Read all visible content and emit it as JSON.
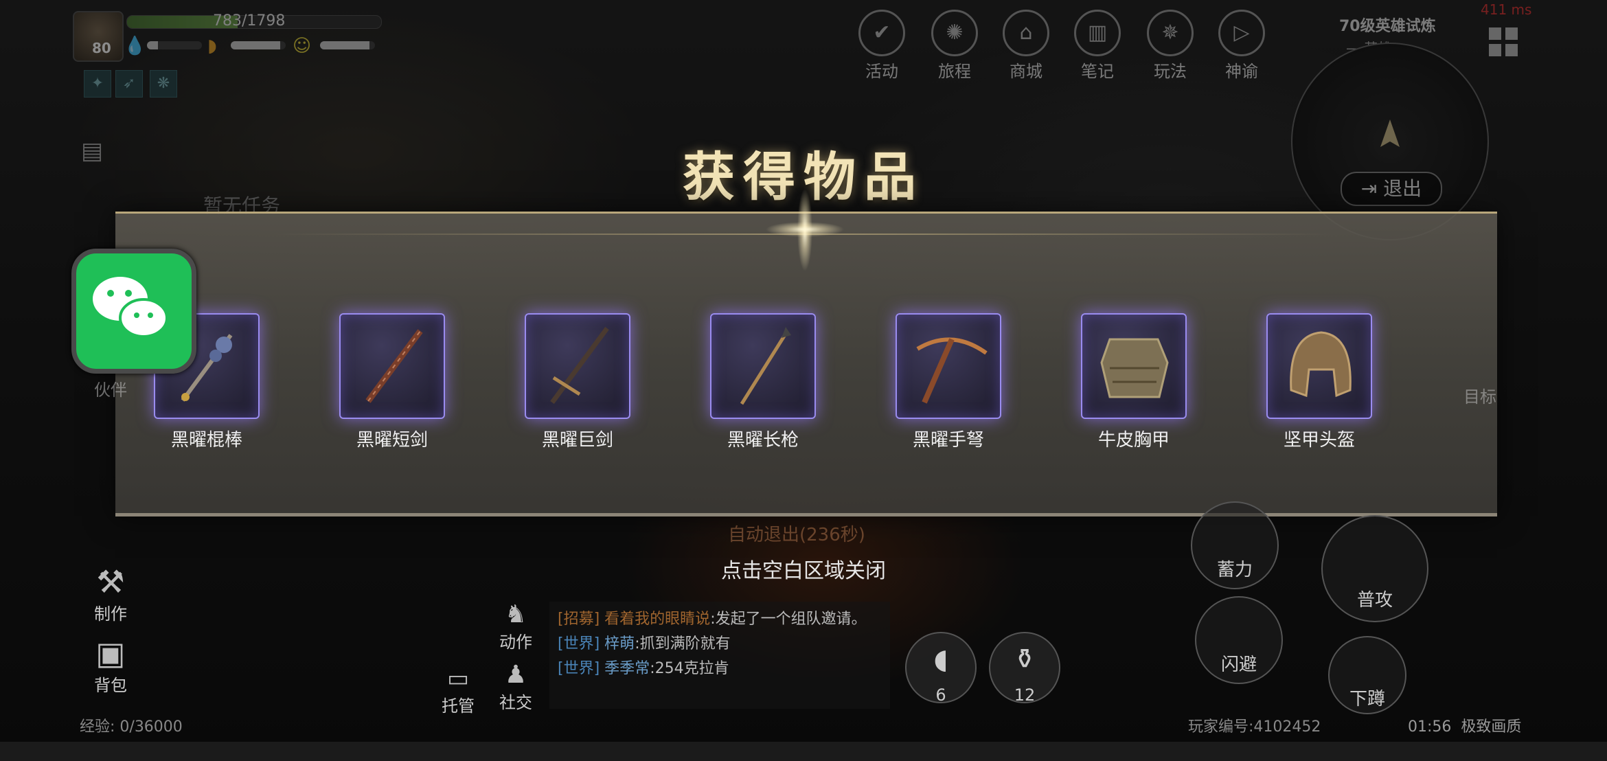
{
  "hud": {
    "level": "80",
    "hp_text": "783/1798",
    "hp_fraction": 0.435,
    "water_fraction": 0.2,
    "hunger_fraction": 0.9,
    "mood_fraction": 0.9,
    "no_task": "暂无任务"
  },
  "top_menu": [
    {
      "label": "活动",
      "icon": "calendar-check-icon"
    },
    {
      "label": "旅程",
      "icon": "journey-icon"
    },
    {
      "label": "商城",
      "icon": "shop-cart-icon"
    },
    {
      "label": "笔记",
      "icon": "notebook-icon"
    },
    {
      "label": "玩法",
      "icon": "compass-icon"
    },
    {
      "label": "神谕",
      "icon": "oracle-icon"
    }
  ],
  "top_right": {
    "trial": "70级英雄试炼",
    "trial_sub": "— 英雄 —",
    "ping": "411 ms",
    "exit": "退出"
  },
  "reward": {
    "title": "获得物品",
    "items": [
      {
        "name": "黑曜棍棒",
        "icon": "mace-icon"
      },
      {
        "name": "黑曜短剑",
        "icon": "short-sword-icon"
      },
      {
        "name": "黑曜巨剑",
        "icon": "great-sword-icon"
      },
      {
        "name": "黑曜长枪",
        "icon": "spear-icon"
      },
      {
        "name": "黑曜手弩",
        "icon": "crossbow-icon"
      },
      {
        "name": "牛皮胸甲",
        "icon": "chest-armor-icon"
      },
      {
        "name": "坚甲头盔",
        "icon": "helmet-icon"
      }
    ],
    "close_hint": "点击空白区域关闭",
    "auto_exit": "自动退出(236秒)"
  },
  "left_buttons": {
    "craft": "制作",
    "bag": "背包",
    "partner": "伙伴"
  },
  "bottom": {
    "action": "动作",
    "social": "社交",
    "auto": "托管",
    "chat": [
      {
        "channel": "[招募]",
        "name": "看着我的眼睛说",
        "text": ":发起了一个组队邀请。",
        "type": "recruit"
      },
      {
        "channel": "[世界]",
        "name": "梓萌",
        "text": ":抓到满阶就有",
        "type": "world"
      },
      {
        "channel": "[世界]",
        "name": "季季常",
        "text": ":254克拉肯",
        "type": "world"
      }
    ],
    "slot1_count": "6",
    "slot2_count": "12",
    "charge": "蓄力",
    "attack": "普攻",
    "dodge": "闪避",
    "crouch": "下蹲",
    "exp": "经验: 0/36000",
    "player_id": "玩家编号:4102452",
    "clock": "01:56",
    "quality": "极致画质",
    "target": "目标"
  }
}
